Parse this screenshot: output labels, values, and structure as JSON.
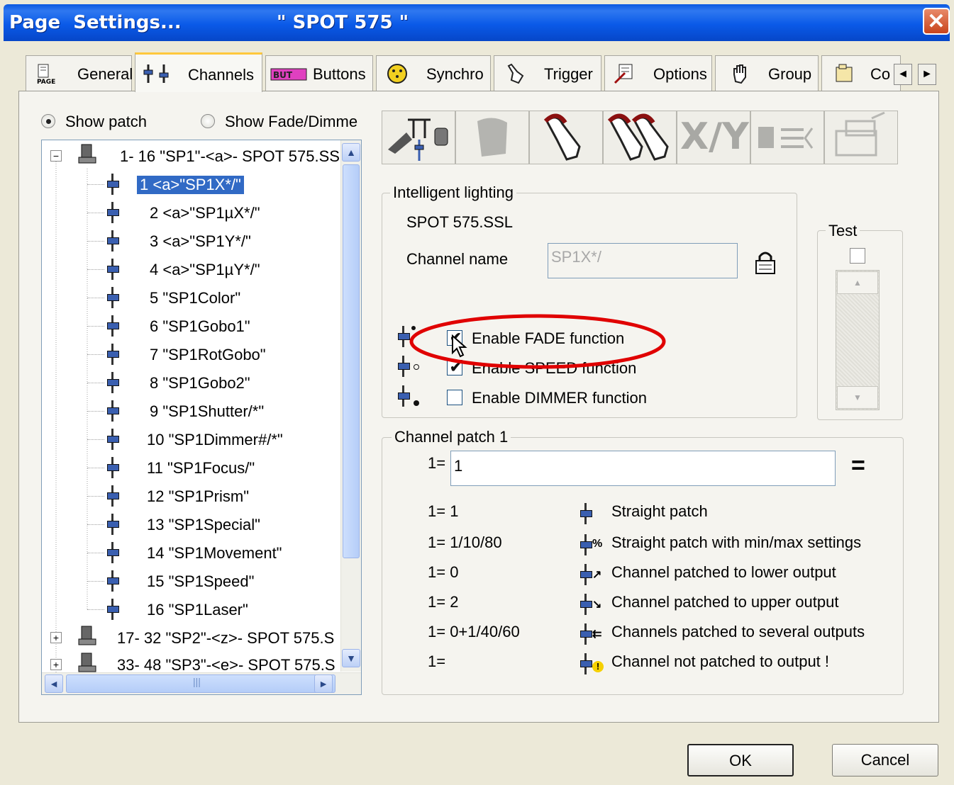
{
  "window": {
    "title": "Page  Settings...",
    "subtitle": "\" SPOT 575 \"",
    "close_label": "✕"
  },
  "tabs": [
    {
      "label": "General",
      "icon": "page-icon"
    },
    {
      "label": "Channels",
      "icon": "faders-icon"
    },
    {
      "label": "Buttons",
      "icon": "button-icon"
    },
    {
      "label": "Synchro",
      "icon": "synchro-icon"
    },
    {
      "label": "Trigger",
      "icon": "hand-icon"
    },
    {
      "label": "Options",
      "icon": "options-icon"
    },
    {
      "label": "Group",
      "icon": "hand-icon"
    },
    {
      "label": "Co",
      "icon": "folder-icon"
    }
  ],
  "tab_scroll": {
    "left": "◄",
    "right": "►"
  },
  "view_mode": {
    "show_patch": "Show patch",
    "show_fade": "Show Fade/Dimme",
    "selected": "show_patch"
  },
  "tree": {
    "group1": {
      "expander": "−",
      "label": "1- 16 \"SP1\"-<a>- SPOT 575.SS"
    },
    "channels": [
      "1 <a>\"SP1X*/\"",
      "2 <a>\"SP1µX*/\"",
      "3 <a>\"SP1Y*/\"",
      "4 <a>\"SP1µY*/\"",
      "5 \"SP1Color\"",
      "6 \"SP1Gobo1\"",
      "7 \"SP1RotGobo\"",
      "8 \"SP1Gobo2\"",
      "9 \"SP1Shutter/*\"",
      "10 \"SP1Dimmer#/*\"",
      "11 \"SP1Focus/\"",
      "12 \"SP1Prism\"",
      "13 \"SP1Special\"",
      "14 \"SP1Movement\"",
      "15 \"SP1Speed\"",
      "16 \"SP1Laser\""
    ],
    "group2": {
      "expander": "+",
      "label": "17- 32 \"SP2\"-<z>- SPOT 575.S"
    },
    "group3": {
      "expander": "+",
      "label": "33- 48 \"SP3\"-<e>- SPOT 575.S"
    },
    "scroll": {
      "up": "▲",
      "down": "▼",
      "left": "◄",
      "right": "►",
      "grip": "|||"
    }
  },
  "toolbar_xy_label": "X/Y",
  "intelligent": {
    "group_label": "Intelligent lighting",
    "fixture": "SPOT 575.SSL",
    "channel_name_label": "Channel name",
    "channel_name_value": "SP1X*/",
    "fade_label": "Enable FADE function",
    "fade_checked": true,
    "speed_label": "Enable SPEED function",
    "speed_checked": true,
    "dimmer_label": "Enable DIMMER function",
    "dimmer_checked": false,
    "check_mark": "✔"
  },
  "test": {
    "label": "Test",
    "up": "▲",
    "down": "▼"
  },
  "patch": {
    "group_label": "Channel patch 1",
    "input_label": "1=",
    "input_value": "1",
    "equals_label": "=",
    "examples": [
      {
        "code": "1= 1",
        "desc": "Straight patch",
        "icon": "straight-patch-icon",
        "suffix": ""
      },
      {
        "code": "1= 1/10/80",
        "desc": "Straight patch with min/max settings",
        "icon": "minmax-patch-icon",
        "suffix": "%"
      },
      {
        "code": "1= 0",
        "desc": "Channel patched to lower output",
        "icon": "lower-patch-icon",
        "suffix": "↗"
      },
      {
        "code": "1= 2",
        "desc": "Channel patched to upper output",
        "icon": "upper-patch-icon",
        "suffix": "↘"
      },
      {
        "code": "1= 0+1/40/60",
        "desc": "Channels patched to several outputs",
        "icon": "multi-patch-icon",
        "suffix": "⇇"
      },
      {
        "code": "1=",
        "desc": "Channel not patched to output !",
        "icon": "not-patched-icon",
        "suffix": "!"
      }
    ]
  },
  "buttons": {
    "ok": "OK",
    "cancel": "Cancel"
  },
  "colors": {
    "titlebar": "#0a5ae8",
    "selection": "#316ac5",
    "highlight_ellipse": "#e00000"
  }
}
